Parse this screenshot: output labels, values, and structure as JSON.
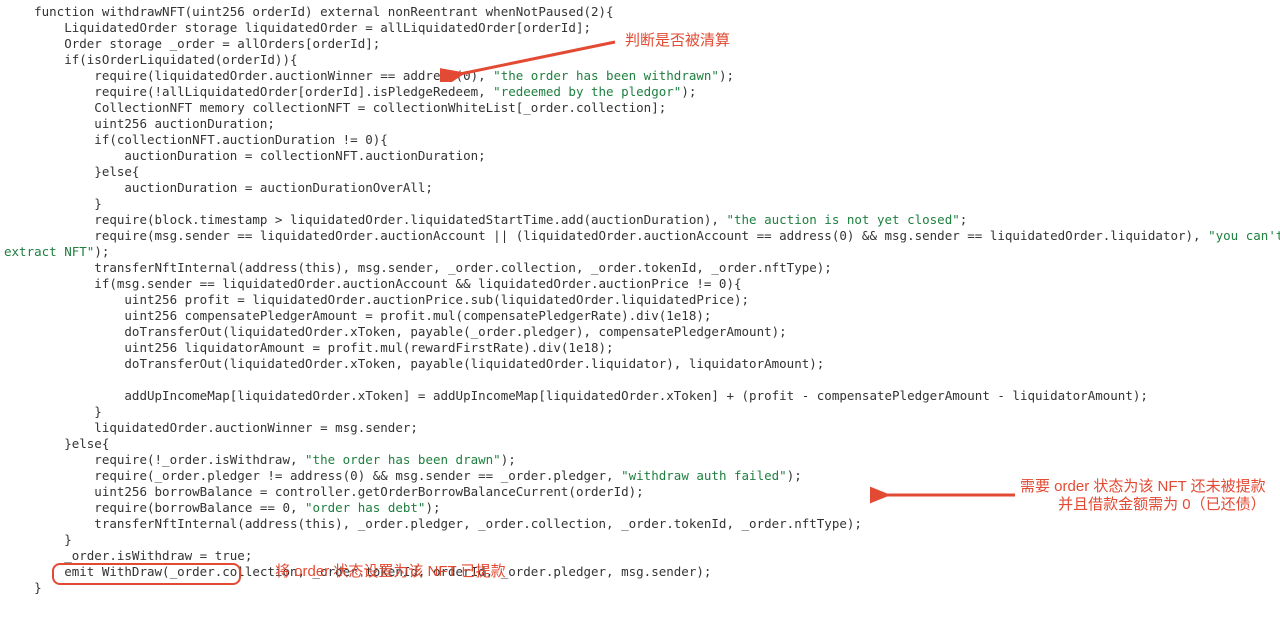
{
  "code": {
    "l01": "    function withdrawNFT(uint256 orderId) external nonReentrant whenNotPaused(2){",
    "l02": "        LiquidatedOrder storage liquidatedOrder = allLiquidatedOrder[orderId];",
    "l03": "        Order storage _order = allOrders[orderId];",
    "l04": "        if(isOrderLiquidated(orderId)){",
    "l05a": "            require(liquidatedOrder.auctionWinner == address(0), ",
    "l05s": "\"the order has been withdrawn\"",
    "l05b": ");",
    "l06a": "            require(!allLiquidatedOrder[orderId].isPledgeRedeem, ",
    "l06s": "\"redeemed by the pledgor\"",
    "l06b": ");",
    "l07": "            CollectionNFT memory collectionNFT = collectionWhiteList[_order.collection];",
    "l08": "            uint256 auctionDuration;",
    "l09": "            if(collectionNFT.auctionDuration != 0){",
    "l10": "                auctionDuration = collectionNFT.auctionDuration;",
    "l11": "            }else{",
    "l12": "                auctionDuration = auctionDurationOverAll;",
    "l13": "            }",
    "l14a": "            require(block.timestamp > liquidatedOrder.liquidatedStartTime.add(auctionDuration), ",
    "l14s": "\"the auction is not yet closed\"",
    "l14b": ";",
    "l15a": "            require(msg.sender == liquidatedOrder.auctionAccount || (liquidatedOrder.auctionAccount == address(0) && msg.sender == liquidatedOrder.liquidator), ",
    "l15s": "\"you can't ",
    "l16s": "extract NFT\"",
    "l16b": ");",
    "l17": "            transferNftInternal(address(this), msg.sender, _order.collection, _order.tokenId, _order.nftType);",
    "l18": "            if(msg.sender == liquidatedOrder.auctionAccount && liquidatedOrder.auctionPrice != 0){",
    "l19": "                uint256 profit = liquidatedOrder.auctionPrice.sub(liquidatedOrder.liquidatedPrice);",
    "l20": "                uint256 compensatePledgerAmount = profit.mul(compensatePledgerRate).div(1e18);",
    "l21": "                doTransferOut(liquidatedOrder.xToken, payable(_order.pledger), compensatePledgerAmount);",
    "l22": "                uint256 liquidatorAmount = profit.mul(rewardFirstRate).div(1e18);",
    "l23": "                doTransferOut(liquidatedOrder.xToken, payable(liquidatedOrder.liquidator), liquidatorAmount);",
    "l24": " ",
    "l25": "                addUpIncomeMap[liquidatedOrder.xToken] = addUpIncomeMap[liquidatedOrder.xToken] + (profit - compensatePledgerAmount - liquidatorAmount);",
    "l26": "            }",
    "l27": "            liquidatedOrder.auctionWinner = msg.sender;",
    "l28": "        }else{",
    "l29a": "            require(!_order.isWithdraw, ",
    "l29s": "\"the order has been drawn\"",
    "l29b": ");",
    "l30a": "            require(_order.pledger != address(0) && msg.sender == _order.pledger, ",
    "l30s": "\"withdraw auth failed\"",
    "l30b": ");",
    "l31": "            uint256 borrowBalance = controller.getOrderBorrowBalanceCurrent(orderId);",
    "l32a": "            require(borrowBalance == 0, ",
    "l32s": "\"order has debt\"",
    "l32b": ");",
    "l33": "            transferNftInternal(address(this), _order.pledger, _order.collection, _order.tokenId, _order.nftType);",
    "l34": "        }",
    "l35": "        _order.isWithdraw = true;",
    "l36": "        emit WithDraw(_order.collection, _order.tokenId, orderId, _order.pledger, msg.sender);",
    "l37": "    }"
  },
  "annotations": {
    "a1": "判断是否被清算",
    "a2_line1": "需要 order 状态为该 NFT 还未被提款",
    "a2_line2": "并且借款金额需为 0（已还债）",
    "a3": "将 order 状态设置为该 NFT 已提款"
  },
  "colors": {
    "accent": "#e34a33",
    "string": "#1e7f3f",
    "keyword": "#9b2393",
    "number": "#2753c1"
  }
}
